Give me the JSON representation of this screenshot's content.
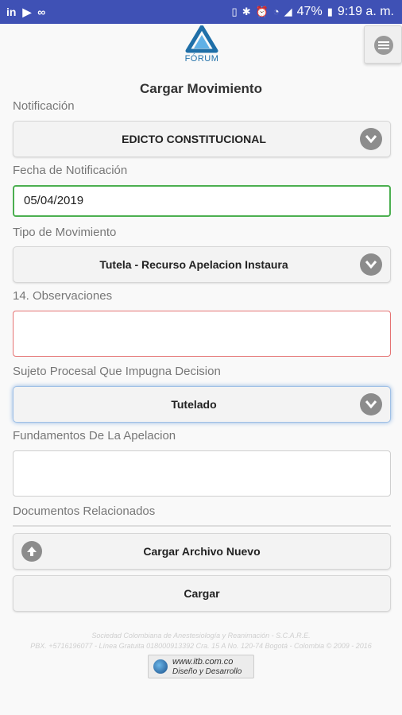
{
  "status_bar": {
    "left_icons": [
      "linkedin-icon",
      "flipboard-icon",
      "voicemail-icon"
    ],
    "left_glyphs": [
      "in",
      "▶",
      "∞"
    ],
    "battery": "47%",
    "time": "9:19 a. m."
  },
  "header": {
    "logo_text": "FÓRUM"
  },
  "form": {
    "title": "Cargar Movimiento",
    "notificacion": {
      "label": "Notificación",
      "value": "EDICTO CONSTITUCIONAL"
    },
    "fecha": {
      "label": "Fecha de Notificación",
      "value": "05/04/2019"
    },
    "tipo": {
      "label": "Tipo de Movimiento",
      "value": "Tutela - Recurso Apelacion Instaura"
    },
    "observaciones": {
      "label": "14. Observaciones",
      "value": ""
    },
    "sujeto": {
      "label": "Sujeto Procesal Que Impugna Decision",
      "value": "Tutelado"
    },
    "fundamentos": {
      "label": "Fundamentos De La Apelacion",
      "value": ""
    },
    "documentos": {
      "label": "Documentos Relacionados"
    },
    "upload_button": "Cargar Archivo Nuevo",
    "submit_button": "Cargar"
  },
  "footer": {
    "line1": "Sociedad Colombiana de Anestesiología y Reanimación - S.C.A.R.E.",
    "line2": "PBX. +5716196077 - Línea Gratuita 018000913392 Cra. 15 A No. 120-74 Bogotá - Colombia © 2009 - 2016",
    "badge_url": "www.itb.com.co",
    "badge_sub": "Diseño y Desarrollo"
  },
  "colors": {
    "status_bar": "#3f51b5",
    "valid": "#4caf50",
    "invalid": "#e57373",
    "focus": "#8db4e2",
    "brand": "#1f6fa8"
  }
}
